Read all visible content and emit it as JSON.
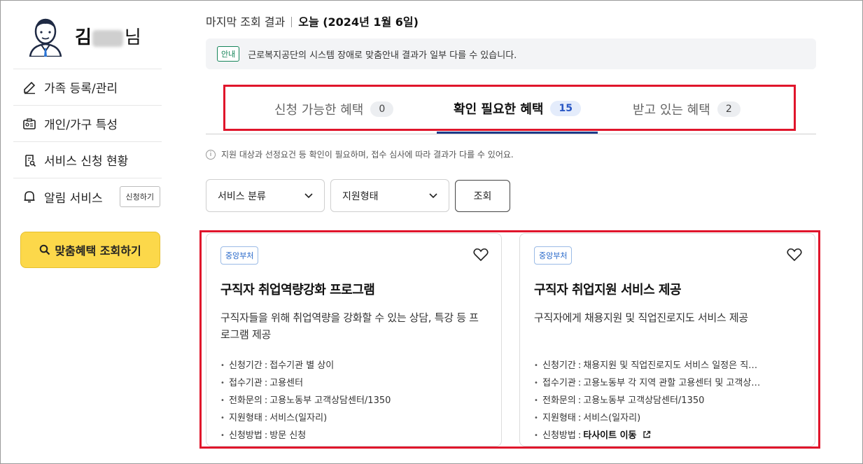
{
  "sidebar": {
    "user_name_prefix": "김",
    "user_name_suffix": "님",
    "items": [
      {
        "label": "가족 등록/관리",
        "icon": "edit-icon"
      },
      {
        "label": "개인/가구 특성",
        "icon": "id-card-icon"
      },
      {
        "label": "서비스 신청 현황",
        "icon": "clipboard-search-icon"
      },
      {
        "label": "알림 서비스",
        "icon": "bell-icon",
        "button": "신청하기"
      }
    ],
    "cta_label": "맞춤혜택 조회하기"
  },
  "header": {
    "result_label": "마지막 조회 결과",
    "today_label": "오늘 (2024년 1월 6일)"
  },
  "notice": {
    "badge": "안내",
    "text": "근로복지공단의 시스템 장애로 맞춤안내 결과가 일부 다를 수 있습니다."
  },
  "tabs": [
    {
      "label": "신청 가능한 혜택",
      "count": "0",
      "active": false
    },
    {
      "label": "확인 필요한 혜택",
      "count": "15",
      "active": true
    },
    {
      "label": "받고 있는 혜택",
      "count": "2",
      "active": false
    }
  ],
  "info_text": "지원 대상과 선정요건 등 확인이 필요하며, 접수 심사에 따라 결과가 다를 수 있어요.",
  "filters": {
    "category": "서비스 분류",
    "support_type": "지원형태",
    "search_label": "조회"
  },
  "cards": [
    {
      "badge": "중앙부처",
      "title": "구직자 취업역량강화 프로그램",
      "description": "구직자들을 위해 취업역량을 강화할 수 있는 상담, 특강 등 프로그램 제공",
      "fields": [
        {
          "key": "신청기간",
          "value": "접수기관 별 상이"
        },
        {
          "key": "접수기관",
          "value": "고용센터"
        },
        {
          "key": "전화문의",
          "value": "고용노동부 고객상담센터/1350"
        },
        {
          "key": "지원형태",
          "value": "서비스(일자리)"
        },
        {
          "key": "신청방법",
          "value": "방문 신청"
        }
      ]
    },
    {
      "badge": "중앙부처",
      "title": "구직자 취업지원 서비스 제공",
      "description": "구직자에게 채용지원 및 직업진로지도 서비스 제공",
      "fields": [
        {
          "key": "신청기간",
          "value": "채용지원 및 직업진로지도 서비스 일정은 직…"
        },
        {
          "key": "접수기관",
          "value": "고용노동부 각 지역 관할 고용센터 및 고객상…"
        },
        {
          "key": "전화문의",
          "value": "고용노동부 고객상담센터/1350"
        },
        {
          "key": "지원형태",
          "value": "서비스(일자리)"
        },
        {
          "key": "신청방법",
          "value": "타사이트 이동"
        }
      ]
    }
  ],
  "colors": {
    "accent_yellow": "#fcd84a",
    "active_tab_underline": "#1d3a8a",
    "highlight_red": "#e0152b",
    "notice_green": "#16855a",
    "badge_blue": "#2667c9"
  }
}
